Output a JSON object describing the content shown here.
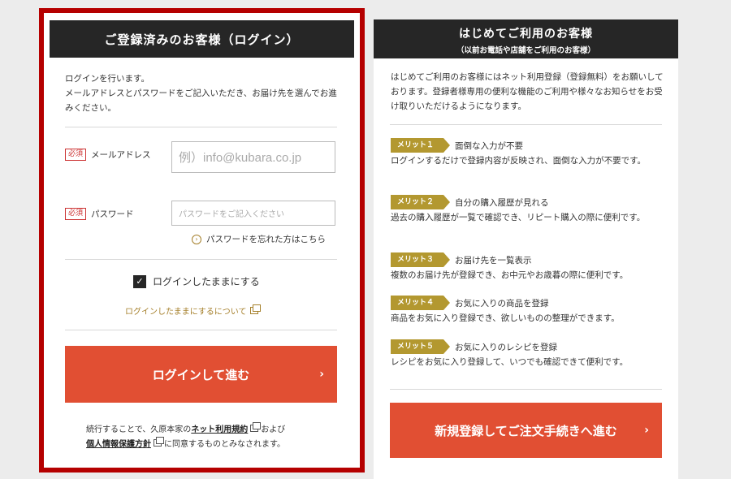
{
  "login": {
    "title": "ご登録済みのお客様（ログイン）",
    "intro": "ログインを行います。\nメールアドレスとパスワードをご記入いただき、お届け先を選んでお進みください。",
    "required_badge": "必須",
    "email_label": "メールアドレス",
    "email_placeholder": "例）info@kubara.co.jp",
    "password_label": "パスワード",
    "password_placeholder": "パスワードをご記入ください",
    "forgot_link": "パスワードを忘れた方はこちら",
    "remember_label": "ログインしたままにする",
    "remember_checked": true,
    "about_remember_link": "ログインしたままにするについて",
    "submit_label": "ログインして進む",
    "terms_prefix": "続行することで、久原本家の",
    "terms_link": "ネット利用規約",
    "terms_mid": "および",
    "privacy_link": "個人情報保護方針",
    "terms_suffix": "に同意するものとみなされます。"
  },
  "register": {
    "title": "はじめてご利用のお客様",
    "subtitle": "（以前お電話や店舗をご利用のお客様）",
    "intro": "はじめてご利用のお客様にはネット利用登録（登録無料）をお願いしております。登録者様専用の便利な機能のご利用や様々なお知らせをお受け取りいただけるようになります。",
    "merits": [
      {
        "badge": "メリット１",
        "title": "面倒な入力が不要",
        "desc": "ログインするだけで登録内容が反映され、面倒な入力が不要です。"
      },
      {
        "badge": "メリット２",
        "title": "自分の購入履歴が見れる",
        "desc": "過去の購入履歴が一覧で確認でき、リピート購入の際に便利です。"
      },
      {
        "badge": "メリット３",
        "title": "お届け先を一覧表示",
        "desc": "複数のお届け先が登録でき、お中元やお歳暮の際に便利です。"
      },
      {
        "badge": "メリット４",
        "title": "お気に入りの商品を登録",
        "desc": "商品をお気に入り登録でき、欲しいものの整理ができます。"
      },
      {
        "badge": "メリット５",
        "title": "お気に入りのレシピを登録",
        "desc": "レシピをお気に入り登録して、いつでも確認できて便利です。"
      }
    ],
    "submit_label": "新規登録してご注文手続きへ進む"
  },
  "colors": {
    "accent": "#e14f33",
    "highlight_border": "#b50000",
    "header_bg": "#262626",
    "badge_gold": "#b39830"
  },
  "icons": {
    "chevron": "chevron-right-icon",
    "circle_arrow": "circle-arrow-icon",
    "external": "external-window-icon",
    "check": "check-icon"
  }
}
